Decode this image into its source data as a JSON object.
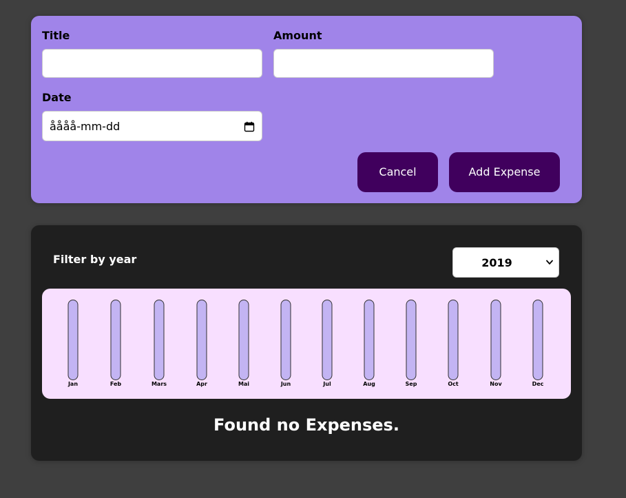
{
  "form": {
    "title_label": "Title",
    "title_value": "",
    "amount_label": "Amount",
    "amount_value": "",
    "date_label": "Date",
    "date_placeholder": "åååå-mm-dd",
    "cancel_label": "Cancel",
    "submit_label": "Add Expense"
  },
  "filter": {
    "label": "Filter by year",
    "selected_year": "2019"
  },
  "chart": {
    "months": [
      "Jan",
      "Feb",
      "Mars",
      "Apr",
      "Mai",
      "Jun",
      "Jul",
      "Aug",
      "Sep",
      "Oct",
      "Nov",
      "Dec"
    ],
    "fill_fractions": [
      0,
      0,
      0,
      0,
      0,
      0,
      0,
      0,
      0,
      0,
      0,
      0
    ]
  },
  "list": {
    "empty_message": "Found no Expenses."
  },
  "colors": {
    "page_bg": "#3f3f3f",
    "form_bg": "#a084e9",
    "button_bg": "#40005d",
    "card_bg": "#1f1f1f",
    "chart_bg": "#f8dfff",
    "bar_empty": "#c3b4f3"
  }
}
